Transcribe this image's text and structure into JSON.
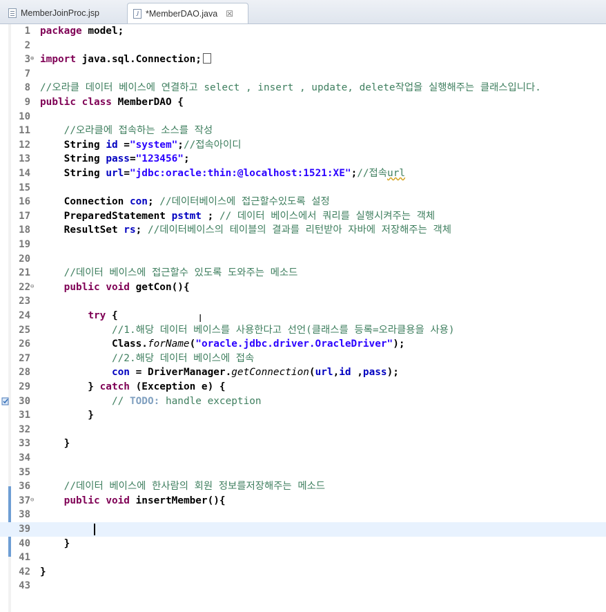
{
  "tabs": [
    {
      "label": "MemberJoinProc.jsp",
      "icon": "jsp-file-icon",
      "active": false
    },
    {
      "label": "*MemberDAO.java",
      "icon": "java-file-icon",
      "active": true,
      "close": "☒"
    }
  ],
  "editor": {
    "current_line": 39,
    "lines": [
      {
        "n": "1",
        "code": "package model;"
      },
      {
        "n": "2",
        "code": ""
      },
      {
        "n": "3",
        "code": "import java.sql.Connection;"
      },
      {
        "n": "7",
        "code": ""
      },
      {
        "n": "8",
        "code": "//오라클 데이터 베이스에 연결하고 select , insert , update, delete작업을 실행해주는 클래스입니다."
      },
      {
        "n": "9",
        "code": "public class MemberDAO {"
      },
      {
        "n": "10",
        "code": ""
      },
      {
        "n": "11",
        "code": "    //오라클에 접속하는 소스를 작성"
      },
      {
        "n": "12",
        "code": "    String id =\"system\";//접속아이디"
      },
      {
        "n": "13",
        "code": "    String pass=\"123456\";"
      },
      {
        "n": "14",
        "code": "    String url=\"jdbc:oracle:thin:@localhost:1521:XE\";//접속url"
      },
      {
        "n": "15",
        "code": ""
      },
      {
        "n": "16",
        "code": "    Connection con; //데이터베이스에 접근할수있도록 설정"
      },
      {
        "n": "17",
        "code": "    PreparedStatement pstmt ; // 데이터 베이스에서 쿼리를 실행시켜주는 객체"
      },
      {
        "n": "18",
        "code": "    ResultSet rs; //데이터베이스의 테이블의 결과를 리턴받아 자바에 저장해주는 객체"
      },
      {
        "n": "19",
        "code": ""
      },
      {
        "n": "20",
        "code": ""
      },
      {
        "n": "21",
        "code": "    //데이터 베이스에 접근할수 있도록 도와주는 메소드"
      },
      {
        "n": "22",
        "code": "    public void getCon(){"
      },
      {
        "n": "23",
        "code": ""
      },
      {
        "n": "24",
        "code": "        try {"
      },
      {
        "n": "25",
        "code": "            //1.해당 데이터 베이스를 사용한다고 선언(클래스를 등록=오라클용을 사용)"
      },
      {
        "n": "26",
        "code": "            Class.forName(\"oracle.jdbc.driver.OracleDriver\");"
      },
      {
        "n": "27",
        "code": "            //2.해당 데이터 베이스에 접속"
      },
      {
        "n": "28",
        "code": "            con = DriverManager.getConnection(url,id ,pass);"
      },
      {
        "n": "29",
        "code": "        } catch (Exception e) {"
      },
      {
        "n": "30",
        "code": "            // TODO: handle exception"
      },
      {
        "n": "31",
        "code": "        }"
      },
      {
        "n": "32",
        "code": ""
      },
      {
        "n": "33",
        "code": "    }"
      },
      {
        "n": "34",
        "code": ""
      },
      {
        "n": "35",
        "code": ""
      },
      {
        "n": "36",
        "code": "    //데이터 베이스에 한사람의 회원 정보를저장해주는 메소드"
      },
      {
        "n": "37",
        "code": "    public void insertMember(){"
      },
      {
        "n": "38",
        "code": ""
      },
      {
        "n": "39",
        "code": ""
      },
      {
        "n": "40",
        "code": "    }"
      },
      {
        "n": "41",
        "code": ""
      },
      {
        "n": "42",
        "code": "}"
      },
      {
        "n": "43",
        "code": ""
      }
    ]
  },
  "colors": {
    "keyword": "#7f0055",
    "string": "#2a00ff",
    "field": "#0000c0",
    "comment": "#3f7f5f",
    "todo": "#7f9fbf",
    "current_line": "#e8f2fe",
    "change_marker": "#6e9ed4"
  }
}
